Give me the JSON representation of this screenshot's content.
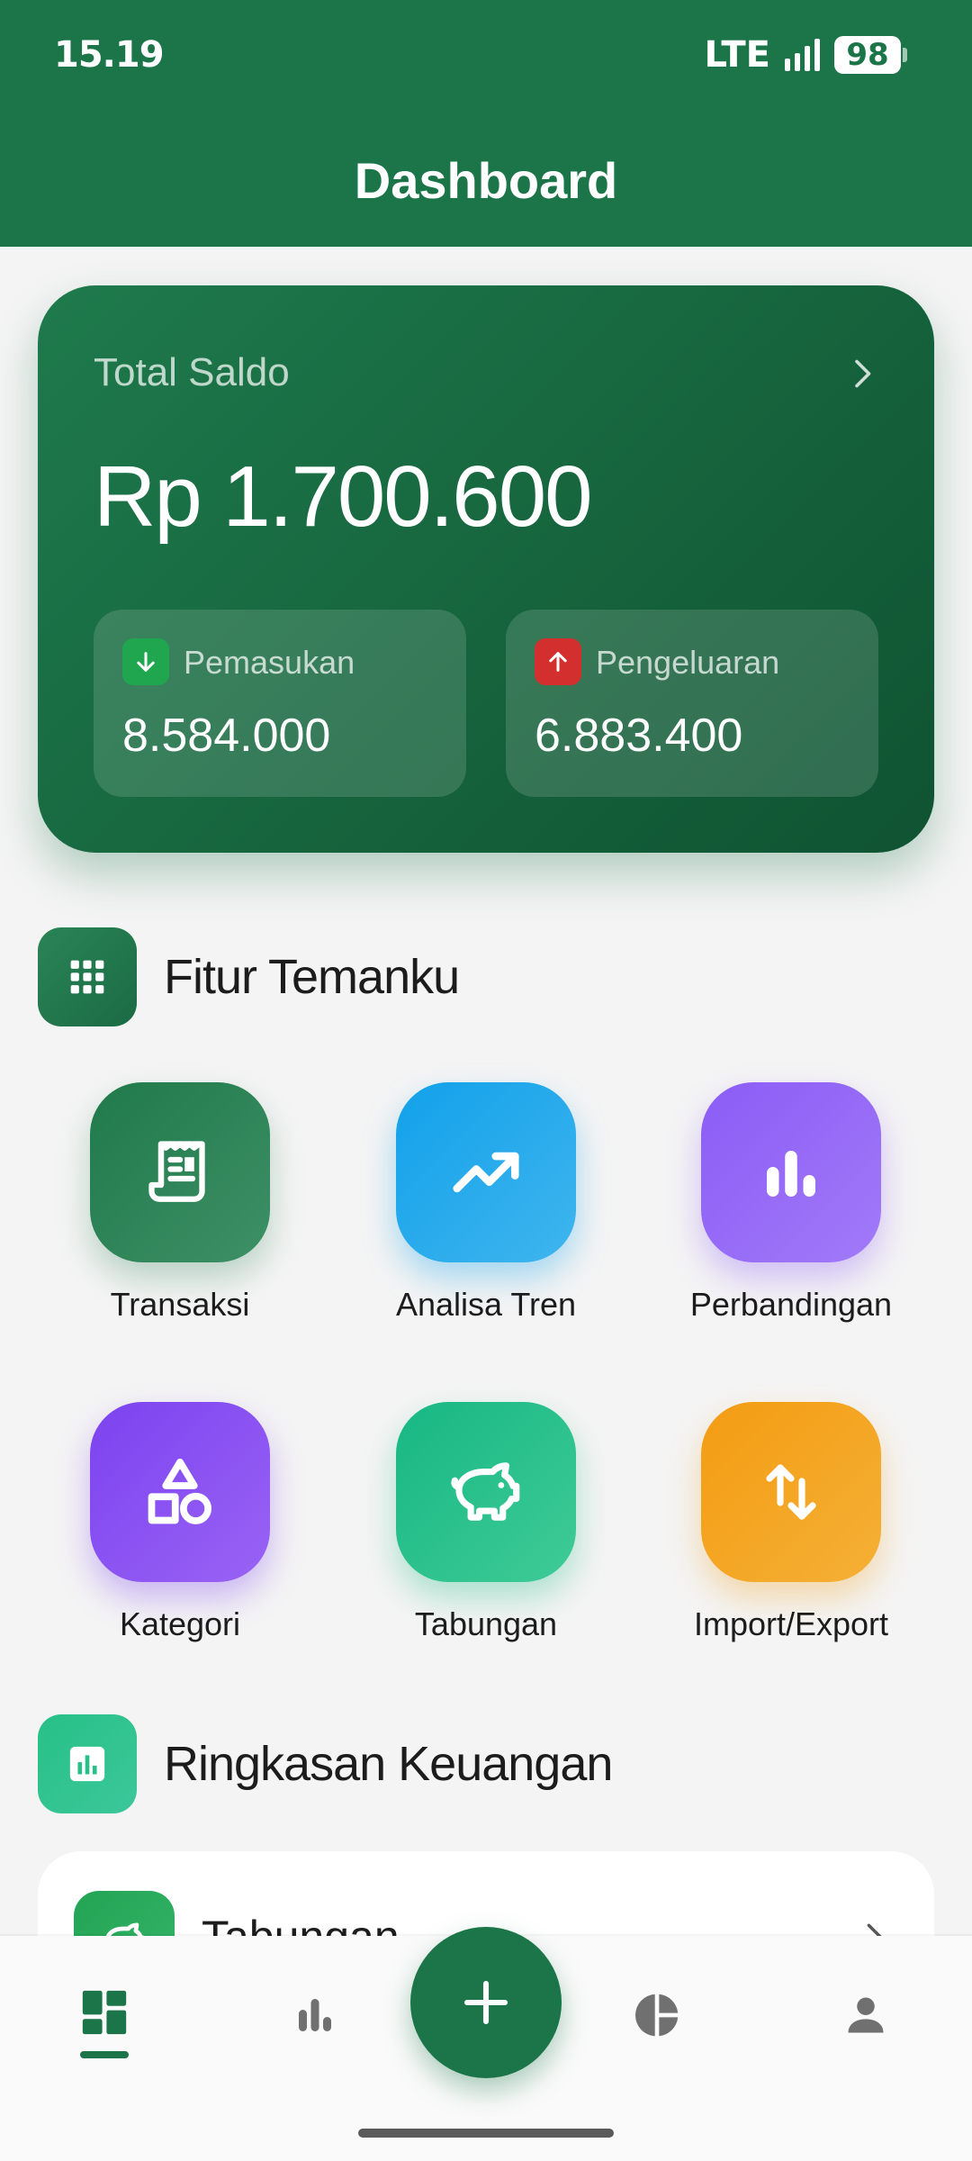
{
  "status_bar": {
    "time": "15.19",
    "network": "LTE",
    "battery": "98"
  },
  "header": {
    "title": "Dashboard"
  },
  "balance": {
    "label": "Total Saldo",
    "value": "Rp 1.700.600",
    "income": {
      "label": "Pemasukan",
      "value": "8.584.000"
    },
    "expense": {
      "label": "Pengeluaran",
      "value": "6.883.400"
    }
  },
  "features": {
    "title": "Fitur Temanku",
    "items": [
      {
        "label": "Transaksi",
        "icon": "receipt-icon"
      },
      {
        "label": "Analisa Tren",
        "icon": "trending-up-icon"
      },
      {
        "label": "Perbandingan",
        "icon": "bar-chart-icon"
      },
      {
        "label": "Kategori",
        "icon": "shapes-icon"
      },
      {
        "label": "Tabungan",
        "icon": "piggy-bank-icon"
      },
      {
        "label": "Import/Export",
        "icon": "swap-vertical-icon"
      }
    ]
  },
  "summary": {
    "title": "Ringkasan Keuangan",
    "first_item": "Tabungan"
  },
  "bottom_nav": {
    "items": [
      "dashboard-icon",
      "stats-icon",
      "add-icon",
      "pie-chart-icon",
      "profile-icon"
    ],
    "active": "dashboard"
  },
  "colors": {
    "primary": "#1b7548",
    "income": "#1fa64f",
    "expense": "#d32f2f"
  }
}
